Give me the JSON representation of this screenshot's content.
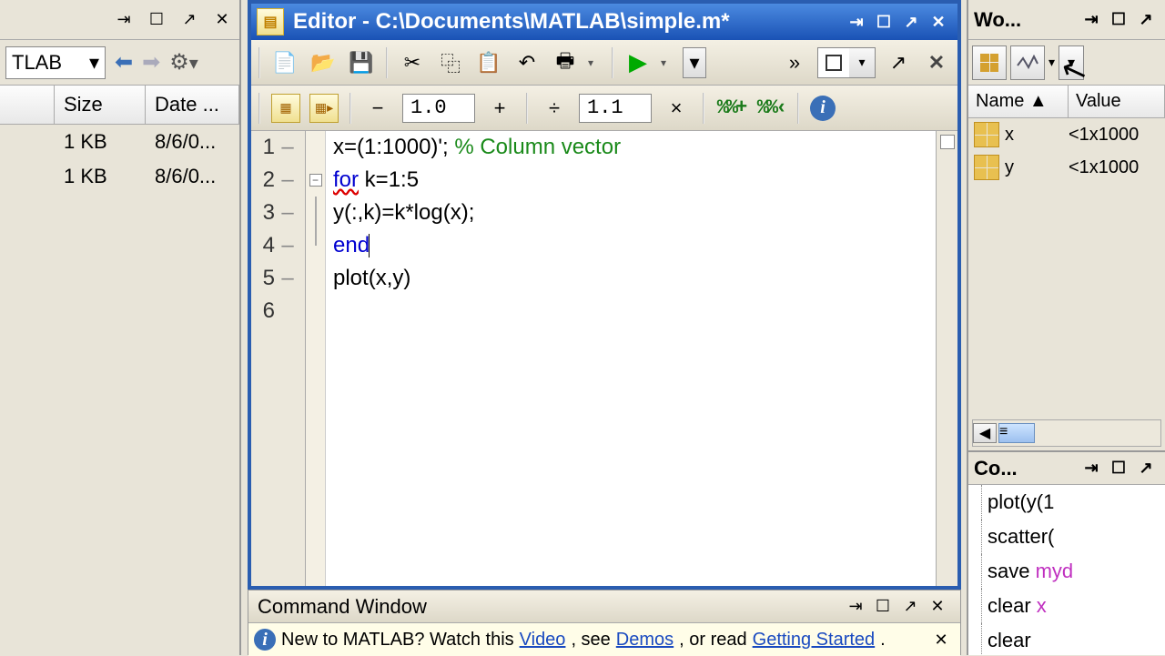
{
  "left": {
    "combo": "TLAB",
    "cols": {
      "size": "Size",
      "date": "Date ..."
    },
    "rows": [
      {
        "size": "1 KB",
        "date": "8/6/0..."
      },
      {
        "size": "1 KB",
        "date": "8/6/0..."
      }
    ]
  },
  "editor": {
    "title": "Editor - C:\\Documents\\MATLAB\\simple.m*",
    "field1": "1.0",
    "field2": "1.1",
    "code": {
      "l1a": "x=(1:1000)'; ",
      "l1b": "% Column vector",
      "l2a": "for",
      "l2b": " k=1:5",
      "l3": "y(:,k)=k*log(x);",
      "l4": "end",
      "l5": "plot(x,y)"
    },
    "lines": [
      "1",
      "2",
      "3",
      "4",
      "5",
      "6"
    ]
  },
  "cmdwin": {
    "title": "Command Window",
    "msg_a": "New to MATLAB? Watch this ",
    "msg_video": "Video",
    "msg_b": ", see ",
    "msg_demos": "Demos",
    "msg_c": ", or read ",
    "msg_gs": "Getting Started",
    "msg_d": "."
  },
  "workspace": {
    "title": "Wo...",
    "cols": {
      "name": "Name",
      "value": "Value"
    },
    "vars": [
      {
        "name": "x",
        "value": "<1x1000"
      },
      {
        "name": "y",
        "value": "<1x1000"
      }
    ]
  },
  "history": {
    "title": "Co...",
    "items": [
      {
        "pre": "plot(y(1",
        "mag": ""
      },
      {
        "pre": "scatter(",
        "mag": ""
      },
      {
        "pre": "save ",
        "mag": "myd"
      },
      {
        "pre": "clear ",
        "mag": "x"
      },
      {
        "pre": "clear",
        "mag": ""
      }
    ]
  }
}
